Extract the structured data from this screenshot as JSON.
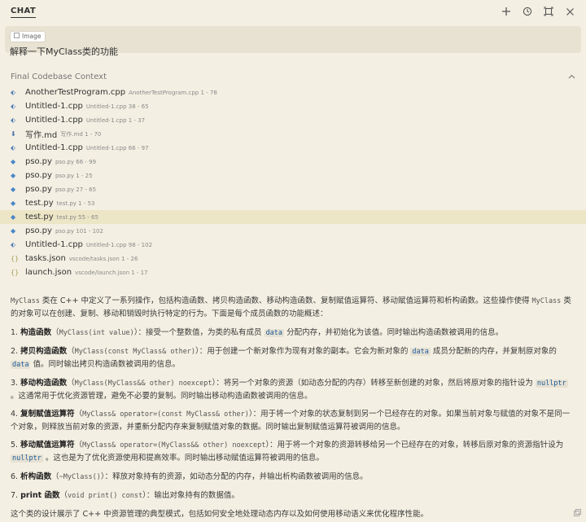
{
  "header": {
    "title": "CHAT",
    "actions": [
      {
        "name": "new-chat-icon",
        "glyph": "+"
      },
      {
        "name": "history-icon",
        "glyph": "⟲"
      },
      {
        "name": "maximize-icon",
        "glyph": "⛶"
      },
      {
        "name": "close-icon",
        "glyph": "✕"
      }
    ]
  },
  "user_message": {
    "chip_label": "Image",
    "text": "解释一下MyClass类的功能"
  },
  "context": {
    "title": "Final Codebase Context",
    "items": [
      {
        "name": "AnotherTestProgram.cpp",
        "path": "AnotherTestProgram.cpp",
        "range": "1 - 78",
        "kind": "cpp"
      },
      {
        "name": "Untitled-1.cpp",
        "path": "Untitled-1.cpp",
        "range": "38 - 65",
        "kind": "cpp"
      },
      {
        "name": "Untitled-1.cpp",
        "path": "Untitled-1.cpp",
        "range": "1 - 37",
        "kind": "cpp"
      },
      {
        "name": "写作.md",
        "path": "写作.md",
        "range": "1 - 70",
        "kind": "md"
      },
      {
        "name": "Untitled-1.cpp",
        "path": "Untitled-1.cpp",
        "range": "66 - 97",
        "kind": "cpp"
      },
      {
        "name": "pso.py",
        "path": "pso.py",
        "range": "66 - 99",
        "kind": "py"
      },
      {
        "name": "pso.py",
        "path": "pso.py",
        "range": "1 - 25",
        "kind": "py"
      },
      {
        "name": "pso.py",
        "path": "pso.py",
        "range": "27 - 65",
        "kind": "py"
      },
      {
        "name": "test.py",
        "path": "test.py",
        "range": "1 - 53",
        "kind": "py"
      },
      {
        "name": "test.py",
        "path": "test.py",
        "range": "55 - 65",
        "kind": "py",
        "highlight": true
      },
      {
        "name": "pso.py",
        "path": "pso.py",
        "range": "101 - 102",
        "kind": "py"
      },
      {
        "name": "Untitled-1.cpp",
        "path": "Untitled-1.cpp",
        "range": "98 - 102",
        "kind": "cpp"
      },
      {
        "name": "tasks.json",
        "path": "vscode/tasks.json",
        "range": "1 - 26",
        "kind": "json"
      },
      {
        "name": "launch.json",
        "path": "vscode/launch.json",
        "range": "1 - 17",
        "kind": "json"
      }
    ]
  },
  "answer": {
    "summary_code": "MyClass",
    "summary_text1": " 类在 C++ 中定义了一系列操作，包括构造函数、拷贝构造函数、移动构造函数、复制赋值运算符、移动赋值运算符和析构函数。这些操作使得 ",
    "summary_code2": "MyClass",
    "summary_text2": " 类的对象可以在创建、复制、移动和销毁时执行特定的行为。下面是每个成员函数的功能概述：",
    "items": [
      {
        "num": "1.",
        "title": "构造函数",
        "sig": "MyClass(int value)",
        "text": "接受一个整数值，为类的私有成员 ",
        "code": "data",
        "text2": " 分配内存，并初始化为该值。同时输出构造函数被调用的信息。"
      },
      {
        "num": "2.",
        "title": "拷贝构造函数",
        "sig": "MyClass(const MyClass& other)",
        "text": "用于创建一个新对象作为现有对象的副本。它会为新对象的 ",
        "code": "data",
        "text2": " 成员分配新的内存，并复制原对象的 ",
        "code2": "data",
        "text3": " 值。同时输出拷贝构造函数被调用的信息。"
      },
      {
        "num": "3.",
        "title": "移动构造函数",
        "sig": "MyClass(MyClass&& other) noexcept",
        "text": "将另一个对象的资源（如动态分配的内存）转移至新创建的对象，然后将原对象的指针设为 ",
        "code": "nullptr",
        "text2": " 。这通常用于优化资源管理，避免不必要的复制。同时输出移动构造函数被调用的信息。"
      },
      {
        "num": "4.",
        "title": "复制赋值运算符",
        "sig": "MyClass& operator=(const MyClass& other)",
        "text": "用于将一个对象的状态复制到另一个已经存在的对象。如果当前对象与赋值的对象不是同一个对象，则释放当前对象的资源，并重新分配内存来复制赋值对象的数据。同时输出复制赋值运算符被调用的信息。"
      },
      {
        "num": "5.",
        "title": "移动赋值运算符",
        "sig": "MyClass& operator=(MyClass&& other) noexcept",
        "text": "用于将一个对象的资源转移给另一个已经存在的对象，转移后原对象的资源指针设为 ",
        "code": "nullptr",
        "text2": " 。这也是为了优化资源使用和提高效率。同时输出移动赋值运算符被调用的信息。"
      },
      {
        "num": "6.",
        "title": "析构函数",
        "sig": "~MyClass()",
        "text": "释放对象持有的资源，如动态分配的内存，并输出析构函数被调用的信息。"
      },
      {
        "num": "7.",
        "title": "print 函数",
        "sig": "void print() const",
        "text": "输出对象持有的数据值。"
      }
    ],
    "conclusion": "这个类的设计展示了 C++ 中资源管理的典型模式，包括如何安全地处理动态内存以及如何使用移动语义来优化程序性能。"
  }
}
